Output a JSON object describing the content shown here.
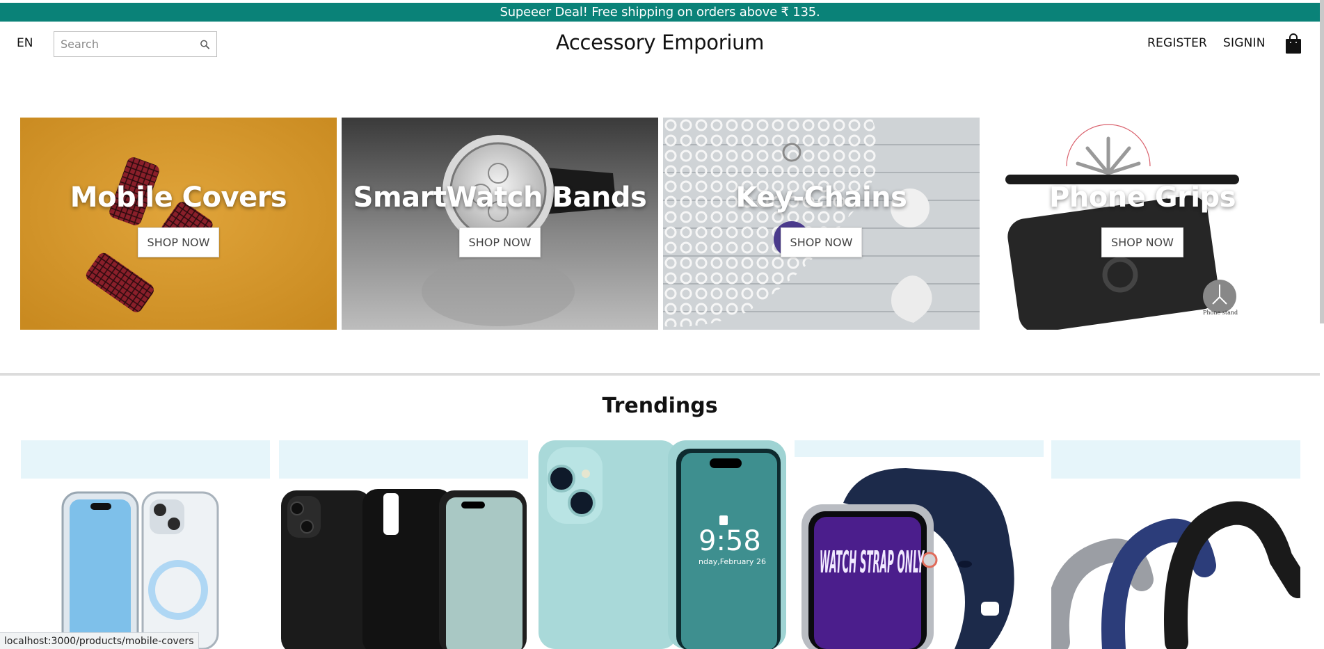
{
  "announcement": "Supeeer Deal! Free shipping on orders above ₹ 135.",
  "nav": {
    "language": "EN",
    "search_placeholder": "Search",
    "logo": "Accessory Emporium",
    "register": "REGISTER",
    "signin": "SIGNIN"
  },
  "categories": [
    {
      "title": "Mobile Covers",
      "button": "SHOP NOW"
    },
    {
      "title": "SmartWatch Bands",
      "button": "SHOP NOW"
    },
    {
      "title": "Key-Chains",
      "button": "SHOP NOW"
    },
    {
      "title": "Phone Grips",
      "button": "SHOP NOW"
    }
  ],
  "phone_grip_caption": "Phone stand",
  "section_title": "Trendings",
  "product_images": {
    "p3_time": "9:58",
    "p3_date": "nday,February 26",
    "p4_screen": "WATCH STRAP ONLY"
  },
  "status_url": "localhost:3000/products/mobile-covers",
  "colors": {
    "announcement_bg": "#0a8278",
    "product_band": "#e6f5fa"
  }
}
